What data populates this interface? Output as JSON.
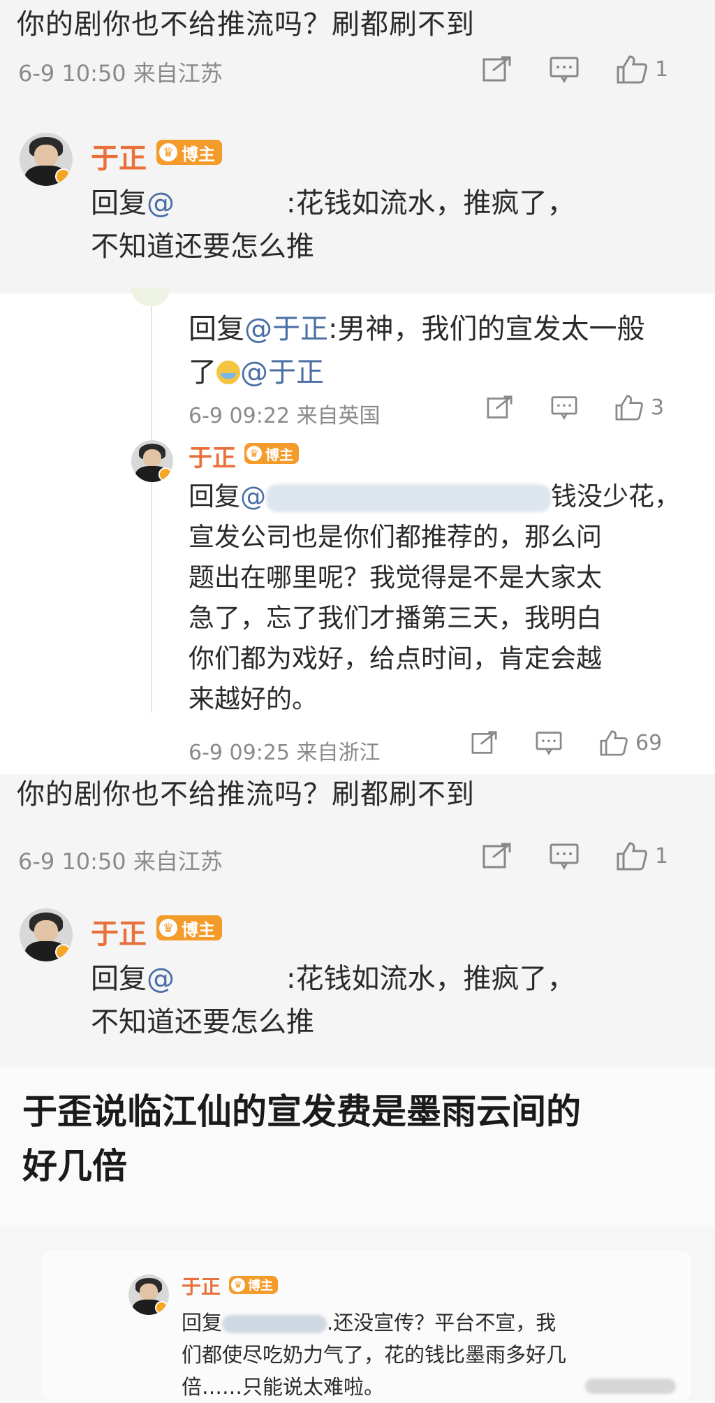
{
  "comment_a": {
    "text": "你的剧你也不给推流吗？刷都刷不到",
    "meta": "6-9 10:50  来自江苏",
    "like_count": "1"
  },
  "reply_a": {
    "name": "于正",
    "badge": "博主",
    "prefix": "回复",
    "mention": "@",
    "line1": ":花钱如流水，推疯了，",
    "line2": "不知道还要怎么推"
  },
  "nested": {
    "reply_line1_prefix": "回复",
    "reply_line1_mention": "@于正",
    "reply_line1_rest": ":男神，我们的宣发太一般",
    "reply_line2_start": "了",
    "reply_line2_mention": "@于正",
    "meta": "6-9 09:22  来自英国",
    "like_count": "3"
  },
  "reply_b": {
    "name": "于正",
    "badge": "博主",
    "prefix": "回复",
    "mention": "@",
    "line1_end": "钱没少花，",
    "lines": [
      "宣发公司也是你们都推荐的，那么问",
      "题出在哪里呢？我觉得是不是大家太",
      "急了，忘了我们才播第三天，我明白",
      "你们都为戏好，给点时间，肯定会越",
      "来越好的。"
    ],
    "meta": "6-9 09:25  来自浙江",
    "like_count": "69"
  },
  "comment_b": {
    "text": "你的剧你也不给推流吗？刷都刷不到",
    "meta": "6-9 10:50  来自江苏",
    "like_count": "1"
  },
  "reply_c": {
    "name": "于正",
    "badge": "博主",
    "prefix": "回复",
    "mention": "@",
    "line1": ":花钱如流水，推疯了，",
    "line2": "不知道还要怎么推"
  },
  "headline": {
    "line1": "于歪说临江仙的宣发费是墨雨云间的",
    "line2": "好几倍"
  },
  "reply_d": {
    "name": "于正",
    "badge": "博主",
    "prefix": "回复",
    "line1_end": ".还没宣传？平台不宣，我",
    "line2": "们都使尽吃奶力气了，花的钱比墨雨多好几",
    "line3": "倍……只能说太难啦。"
  },
  "icons": [
    "share-icon",
    "comment-icon",
    "like-icon"
  ],
  "colors": {
    "name": "#e8703a",
    "badge": "#f39b2b",
    "mention": "#4a6fa5",
    "meta": "#8a8a8a"
  }
}
